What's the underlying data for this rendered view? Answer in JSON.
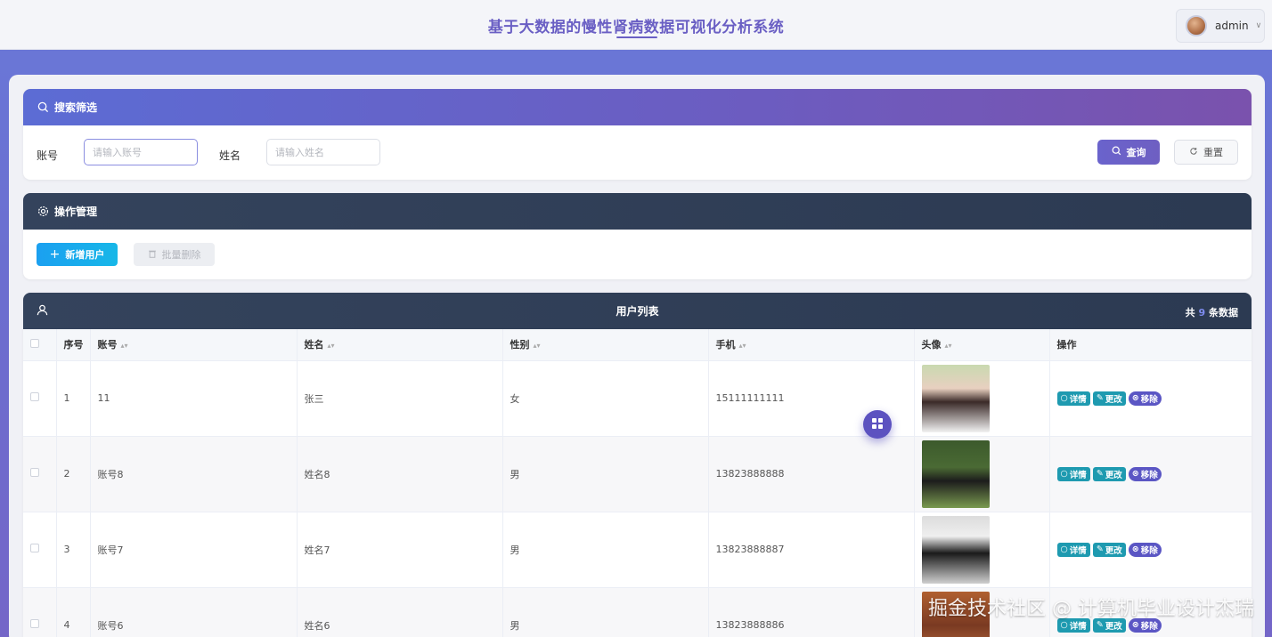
{
  "header": {
    "title": "基于大数据的慢性肾病数据可视化分析系统",
    "user": "admin"
  },
  "search": {
    "title": "搜索筛选",
    "account_label": "账号",
    "account_placeholder": "请输入账号",
    "name_label": "姓名",
    "name_placeholder": "请输入姓名",
    "query_label": "查询",
    "reset_label": "重置"
  },
  "ops": {
    "title": "操作管理",
    "add_label": "新增用户",
    "batch_delete_label": "批量删除"
  },
  "list": {
    "title": "用户列表",
    "count_prefix": "共",
    "count": "9",
    "count_suffix": "条数据",
    "columns": [
      "序号",
      "账号",
      "姓名",
      "性别",
      "手机",
      "头像",
      "操作"
    ],
    "actions": {
      "detail": "详情",
      "edit": "更改",
      "delete": "移除"
    },
    "rows": [
      {
        "index": "1",
        "account": "11",
        "name": "张三",
        "gender": "女",
        "phone": "15111111111"
      },
      {
        "index": "2",
        "account": "账号8",
        "name": "姓名8",
        "gender": "男",
        "phone": "13823888888"
      },
      {
        "index": "3",
        "account": "账号7",
        "name": "姓名7",
        "gender": "男",
        "phone": "13823888887"
      },
      {
        "index": "4",
        "account": "账号6",
        "name": "姓名6",
        "gender": "男",
        "phone": "13823888886"
      }
    ]
  },
  "watermark": "掘金技术社区 @ 计算机毕业设计杰瑞",
  "colors": {
    "accent": "#6a5fc4",
    "primary_button": "#6a63cc",
    "add_button": "#1ba0f0",
    "action_teal": "#1e9ab0",
    "action_purple": "#5b56c4"
  }
}
